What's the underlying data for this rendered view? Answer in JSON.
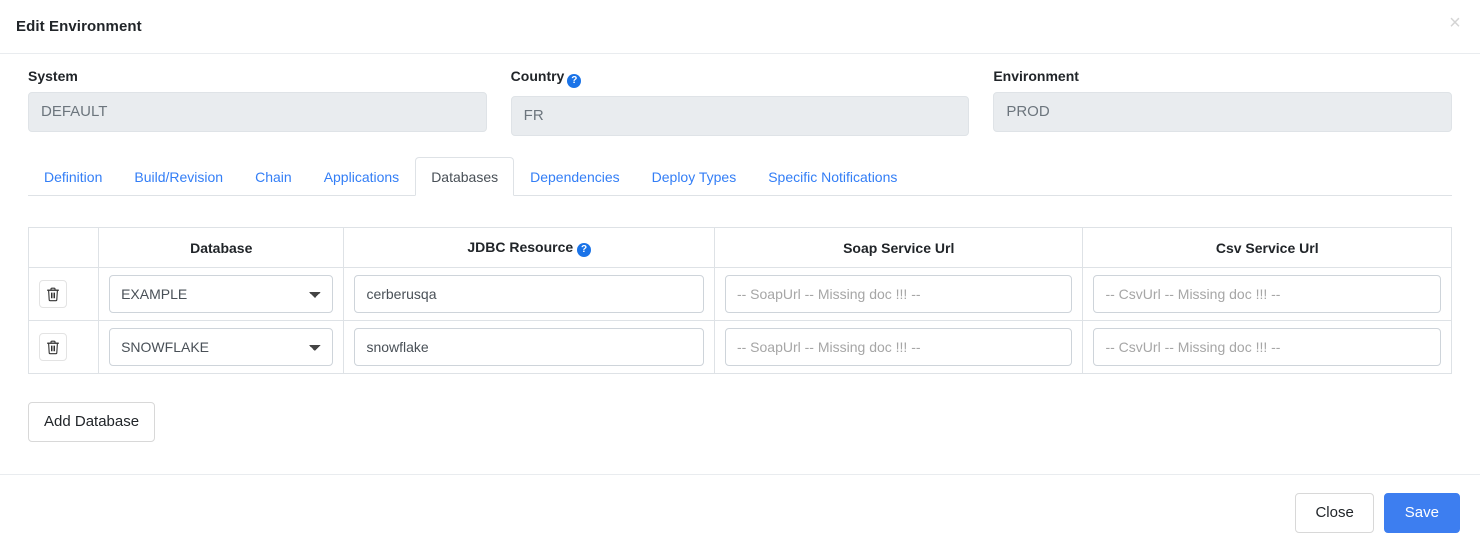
{
  "modal": {
    "title": "Edit Environment",
    "close_icon": "close-icon"
  },
  "fields": {
    "system": {
      "label": "System",
      "value": "DEFAULT"
    },
    "country": {
      "label": "Country",
      "value": "FR",
      "help_icon": "help-circle-icon"
    },
    "environment": {
      "label": "Environment",
      "value": "PROD"
    }
  },
  "tabs": [
    {
      "label": "Definition",
      "active": false
    },
    {
      "label": "Build/Revision",
      "active": false
    },
    {
      "label": "Chain",
      "active": false
    },
    {
      "label": "Applications",
      "active": false
    },
    {
      "label": "Databases",
      "active": true
    },
    {
      "label": "Dependencies",
      "active": false
    },
    {
      "label": "Deploy Types",
      "active": false
    },
    {
      "label": "Specific Notifications",
      "active": false
    }
  ],
  "table": {
    "headers": {
      "action": "",
      "database": "Database",
      "jdbc": "JDBC Resource",
      "jdbc_help_icon": "help-circle-icon",
      "soap": "Soap Service Url",
      "csv": "Csv Service Url"
    },
    "rows": [
      {
        "delete_icon": "trash-icon",
        "database": "EXAMPLE",
        "jdbc": "cerberusqa",
        "soap": "",
        "soap_placeholder": "-- SoapUrl -- Missing doc !!! --",
        "csv": "",
        "csv_placeholder": "-- CsvUrl -- Missing doc !!! --"
      },
      {
        "delete_icon": "trash-icon",
        "database": "SNOWFLAKE",
        "jdbc": "snowflake",
        "soap": "",
        "soap_placeholder": "-- SoapUrl -- Missing doc !!! --",
        "csv": "",
        "csv_placeholder": "-- CsvUrl -- Missing doc !!! --"
      }
    ],
    "database_options": [
      "EXAMPLE",
      "SNOWFLAKE"
    ]
  },
  "actions": {
    "add_database": "Add Database",
    "close": "Close",
    "save": "Save"
  },
  "colors": {
    "primary": "#3d7ef0",
    "link": "#337ef6",
    "help_icon": "#1a73e8",
    "disabled_bg": "#e9ecef",
    "border": "#dee2e6"
  }
}
